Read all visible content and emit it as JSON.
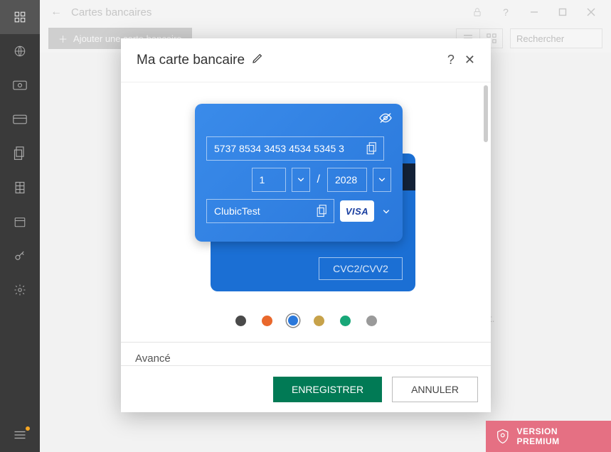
{
  "topbar": {
    "title": "Cartes bancaires"
  },
  "toolbar": {
    "add_label": "Ajouter une carte bancaire",
    "search_placeholder": "Rechercher"
  },
  "bg_tail": "nt.",
  "modal": {
    "title": "Ma carte bancaire",
    "advanced_label": "Avancé",
    "save_label": "ENREGISTRER",
    "cancel_label": "ANNULER"
  },
  "card": {
    "number": "5737 8534 3453 4534 5345 3",
    "exp_month": "1",
    "exp_separator": "/",
    "exp_year": "2028",
    "holder": "ClubicTest",
    "brand": "VISA",
    "cvc_placeholder": "CVC2/CVV2"
  },
  "colors": {
    "options": [
      "#4a4a4a",
      "#e9682c",
      "#2a78db",
      "#c7a24a",
      "#18a778",
      "#9a9a9a"
    ],
    "selected_index": 2
  },
  "premium": {
    "label": "VERSION PREMIUM"
  }
}
